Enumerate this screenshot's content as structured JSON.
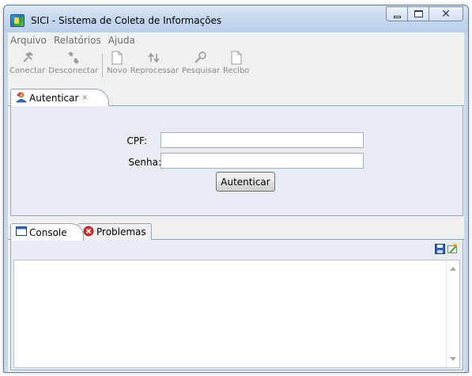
{
  "window": {
    "title": "SICI - Sistema de Coleta de Informações",
    "icons": {
      "app": "sici-app-icon",
      "minimize": "minimize-icon",
      "maximize": "maximize-icon",
      "close": "close-icon"
    },
    "close_glyph": "✕"
  },
  "menu": {
    "items": [
      {
        "label": "Arquivo"
      },
      {
        "label": "Relatórios"
      },
      {
        "label": "Ajuda"
      }
    ]
  },
  "toolbar": {
    "items": [
      {
        "label": "Conectar",
        "icon": "connect-icon",
        "enabled": false
      },
      {
        "label": "Desconectar",
        "icon": "disconnect-icon",
        "enabled": false
      },
      {
        "label": "Novo",
        "icon": "new-document-icon",
        "enabled": false
      },
      {
        "label": "Reprocessar",
        "icon": "reprocess-icon",
        "enabled": false
      },
      {
        "label": "Pesquisar",
        "icon": "search-icon",
        "enabled": false
      },
      {
        "label": "Recibo",
        "icon": "receipt-icon",
        "enabled": false
      }
    ]
  },
  "editor": {
    "tab": {
      "label": "Autenticar",
      "icon": "user-key-icon",
      "close_glyph": "✕"
    },
    "form": {
      "cpf_label": "CPF:",
      "cpf_value": "",
      "senha_label": "Senha:",
      "senha_value": "",
      "submit_label": "Autenticar"
    }
  },
  "bottom": {
    "tabs": [
      {
        "label": "Console",
        "icon": "console-icon",
        "active": true
      },
      {
        "label": "Problemas",
        "icon": "error-icon",
        "active": false
      }
    ],
    "tools": [
      {
        "icon": "save-icon"
      },
      {
        "icon": "clear-console-icon"
      }
    ],
    "console_text": ""
  },
  "colors": {
    "frame": "#c7d8ec",
    "panel": "#e7ecf2",
    "disabled_text": "#8a8a8a",
    "error_red": "#d0312d"
  }
}
